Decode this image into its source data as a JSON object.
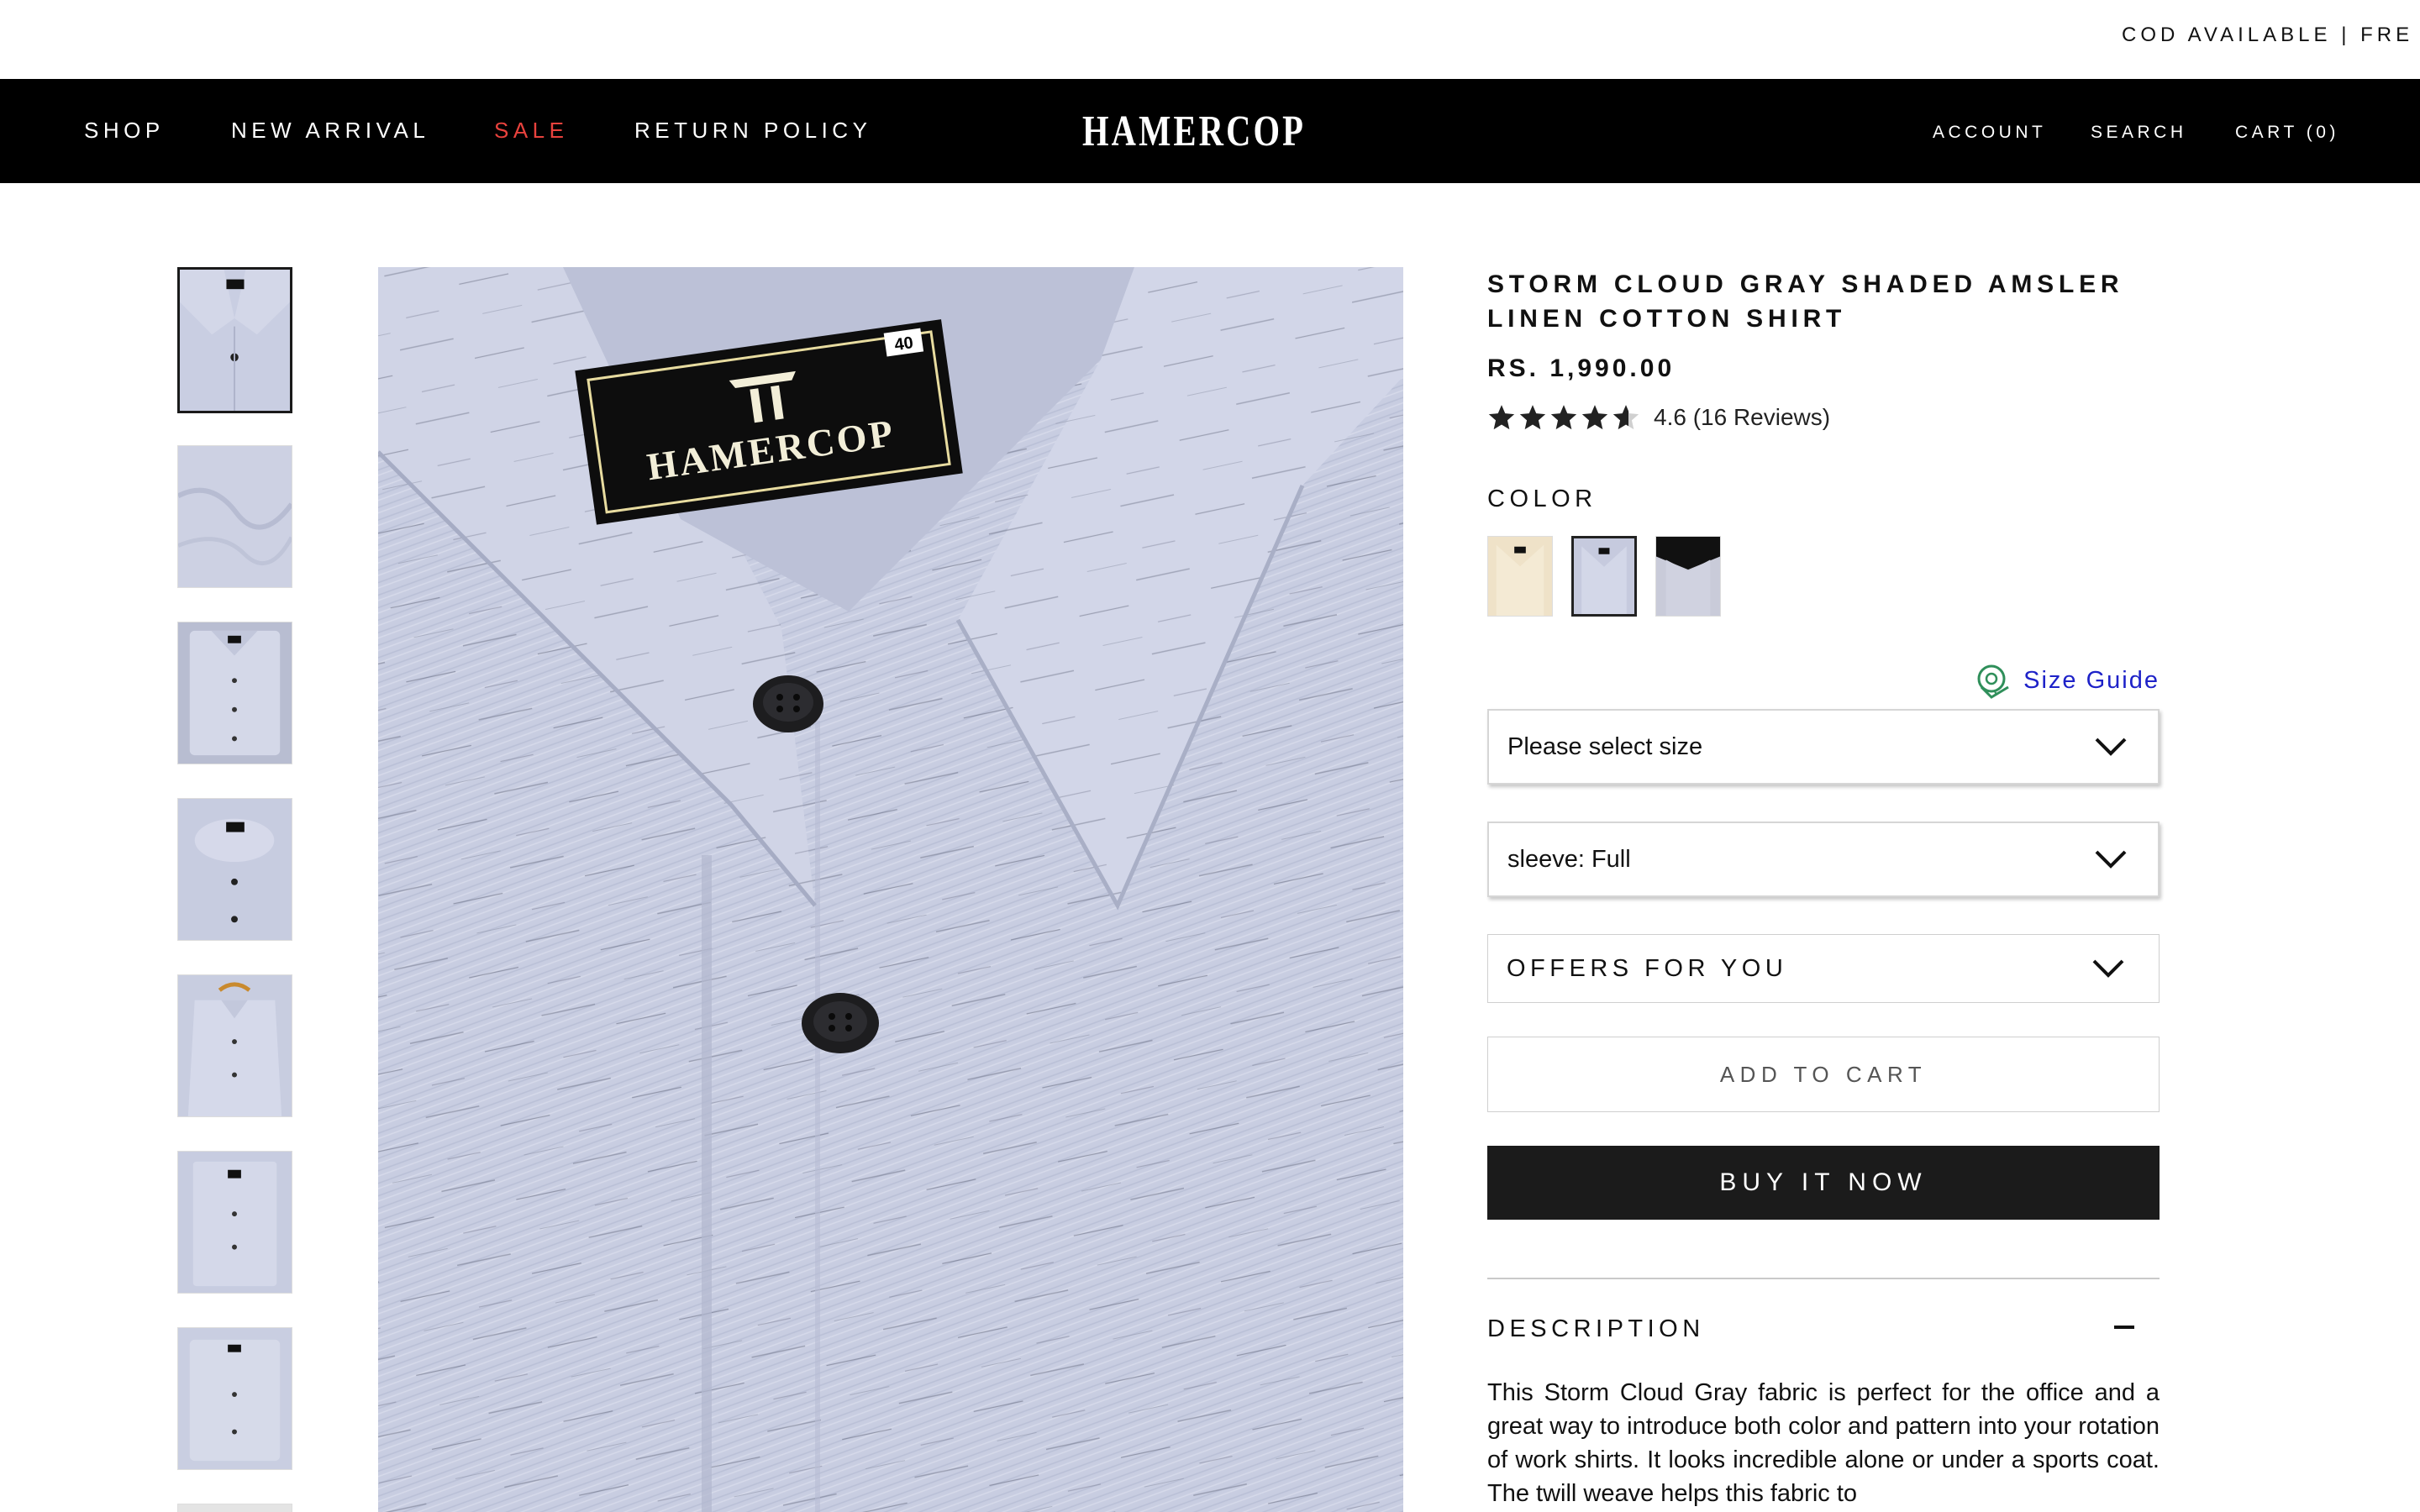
{
  "announcement": {
    "text": "COD AVAILABLE | FRE"
  },
  "header": {
    "nav": [
      "SHOP",
      "NEW ARRIVAL",
      "SALE",
      "RETURN POLICY"
    ],
    "logo_text": "HAMERCOP",
    "account": "ACCOUNT",
    "search": "SEARCH",
    "cart": "CART (0)"
  },
  "product": {
    "title": "STORM CLOUD GRAY SHADED AMSLER LINEN COTTON SHIRT",
    "price": "RS. 1,990.00",
    "rating_value": 4.6,
    "rating_text": "4.6 (16 Reviews)",
    "color_label": "COLOR",
    "colors": [
      {
        "name": "beige",
        "hex": "#efe2c8",
        "selected": false
      },
      {
        "name": "storm-cloud-gray",
        "hex": "#c6cade",
        "selected": true
      },
      {
        "name": "gray-black-collar",
        "hex": "#c9cbd9",
        "selected": false
      }
    ],
    "size_guide": "Size Guide",
    "size_select": "Please select size",
    "sleeve_select": "sleeve: Full",
    "offers": "OFFERS FOR YOU",
    "add_to_cart": "ADD TO CART",
    "buy_now": "BUY IT NOW",
    "description_heading": "DESCRIPTION",
    "description": "This Storm Cloud Gray fabric is perfect for the office and a great way to introduce both color and pattern into your rotation of work shirts. It looks incredible alone or under a sports coat. The twill weave helps this fabric to",
    "label_brand": "HAMERCOP",
    "label_size": "40"
  },
  "colors": {
    "fabric": "#c6cbe0",
    "header_bg": "#000000",
    "sale": "#e8423d",
    "link": "#1e22c8",
    "button_dark": "#1b1b1b"
  }
}
